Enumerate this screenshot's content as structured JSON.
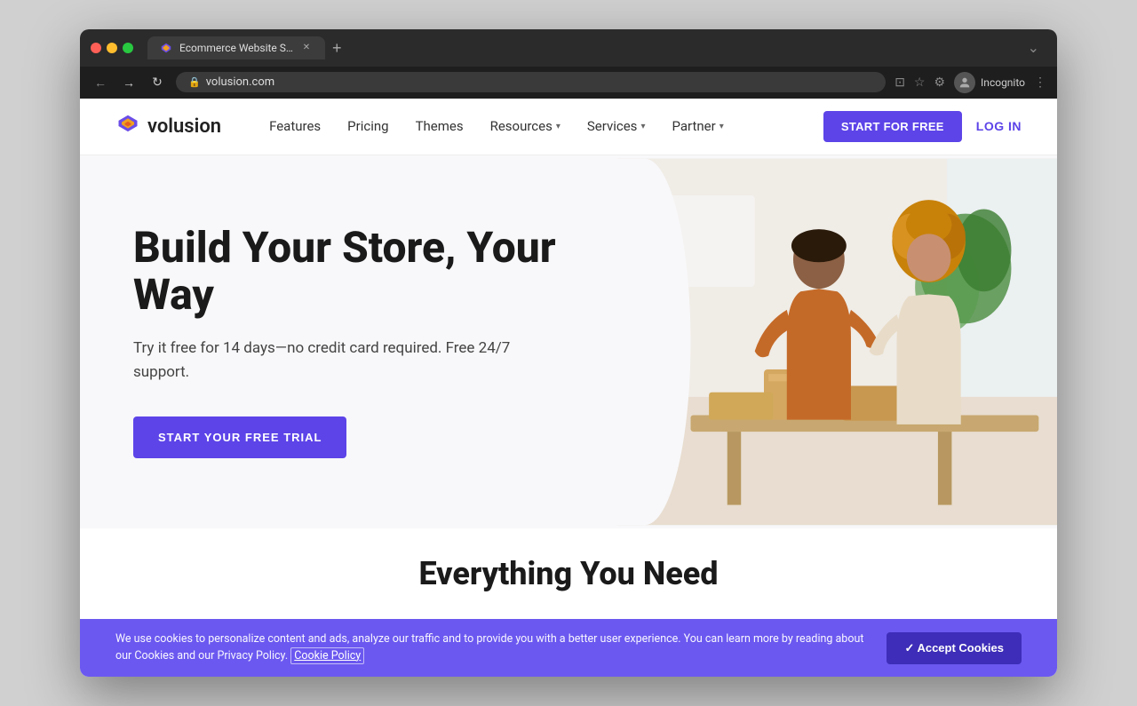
{
  "browser": {
    "tab_title": "Ecommerce Website Store & S",
    "url": "volusion.com",
    "incognito_label": "Incognito"
  },
  "nav": {
    "logo_text": "volusion",
    "links": [
      {
        "label": "Features",
        "has_dropdown": false
      },
      {
        "label": "Pricing",
        "has_dropdown": false
      },
      {
        "label": "Themes",
        "has_dropdown": false
      },
      {
        "label": "Resources",
        "has_dropdown": true
      },
      {
        "label": "Services",
        "has_dropdown": true
      },
      {
        "label": "Partner",
        "has_dropdown": true
      }
    ],
    "cta_button": "START FOR FREE",
    "login_button": "LOG IN"
  },
  "hero": {
    "title": "Build Your Store, Your Way",
    "subtitle": "Try it free for 14 days—no credit card required. Free 24/7 support.",
    "cta_button": "START YOUR FREE TRIAL"
  },
  "section_teaser": {
    "title": "Everything You Need"
  },
  "cookie": {
    "text": "We use cookies to personalize content and ads, analyze our traffic and to provide you with a better user experience. You can learn more by reading about our Cookies and our Privacy Policy.",
    "link_text": "Cookie Policy",
    "accept_button": "✓ Accept Cookies"
  },
  "colors": {
    "brand_purple": "#5c44e8",
    "cookie_bg": "#6b58f0"
  }
}
